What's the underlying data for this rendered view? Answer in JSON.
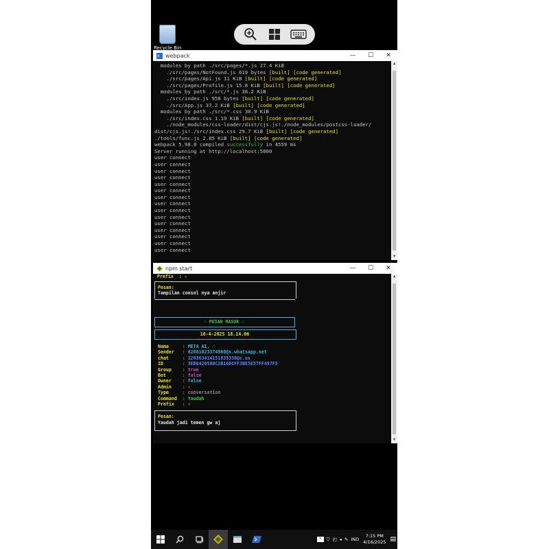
{
  "desktop": {
    "recycle_bin_label": "Recycle Bin"
  },
  "webpack_window": {
    "title": "webpack",
    "lines": [
      [
        {
          "t": "  modules by path ./src/pages/*.js 27.4 KiB",
          "c": ""
        }
      ],
      [
        {
          "t": "    ./src/pages/NotFound.js 619 bytes ",
          "c": ""
        },
        {
          "t": "[built]",
          "c": "y"
        },
        {
          "t": " [code generated]",
          "c": "y"
        }
      ],
      [
        {
          "t": "    ./src/pages/Api.js 11 KiB ",
          "c": ""
        },
        {
          "t": "[built]",
          "c": "y"
        },
        {
          "t": " [code generated]",
          "c": "y"
        }
      ],
      [
        {
          "t": "    ./src/pages/Profile.js 15.8 KiB ",
          "c": ""
        },
        {
          "t": "[built]",
          "c": "y"
        },
        {
          "t": " [code generated]",
          "c": "y"
        }
      ],
      [
        {
          "t": "  modules by path ./src/*.js 38.2 KiB",
          "c": ""
        }
      ],
      [
        {
          "t": "    ./src/index.js 958 bytes ",
          "c": ""
        },
        {
          "t": "[built]",
          "c": "y"
        },
        {
          "t": " [code generated]",
          "c": "y"
        }
      ],
      [
        {
          "t": "    ./src/App.js 37.2 KiB ",
          "c": ""
        },
        {
          "t": "[built]",
          "c": "y"
        },
        {
          "t": " [code generated]",
          "c": "y"
        }
      ],
      [
        {
          "t": "  modules by path ./src/*.css 30.9 KiB",
          "c": ""
        }
      ],
      [
        {
          "t": "    ./src/index.css 1.19 KiB ",
          "c": ""
        },
        {
          "t": "[built]",
          "c": "y"
        },
        {
          "t": " [code generated]",
          "c": "y"
        }
      ],
      [
        {
          "t": "    ./node_modules/css-loader/dist/cjs.js!./node_modules/postcss-loader/",
          "c": ""
        }
      ],
      [
        {
          "t": "dist/cjs.js!./src/index.css 29.7 KiB ",
          "c": ""
        },
        {
          "t": "[built]",
          "c": "y"
        },
        {
          "t": " [code generated]",
          "c": "y"
        }
      ],
      [
        {
          "t": "./tools/func.js 2.85 KiB ",
          "c": ""
        },
        {
          "t": "[built]",
          "c": "y"
        },
        {
          "t": " [code generated]",
          "c": "y"
        }
      ],
      [
        {
          "t": "webpack 5.98.0 compiled ",
          "c": ""
        },
        {
          "t": "successfully",
          "c": "g"
        },
        {
          "t": " in 4559 ms",
          "c": ""
        }
      ],
      [
        {
          "t": "Server running at http://localhost:5000",
          "c": ""
        }
      ],
      [
        {
          "t": "user connect",
          "c": ""
        }
      ],
      [
        {
          "t": "user connect",
          "c": ""
        }
      ],
      [
        {
          "t": "user connect",
          "c": ""
        }
      ],
      [
        {
          "t": "user connect",
          "c": ""
        }
      ],
      [
        {
          "t": "user connect",
          "c": ""
        }
      ],
      [
        {
          "t": "user connect",
          "c": ""
        }
      ],
      [
        {
          "t": "user connect",
          "c": ""
        }
      ],
      [
        {
          "t": "user connect",
          "c": ""
        }
      ],
      [
        {
          "t": "user connect",
          "c": ""
        }
      ],
      [
        {
          "t": "user connect",
          "c": ""
        }
      ],
      [
        {
          "t": "user connect",
          "c": ""
        }
      ],
      [
        {
          "t": "user connect",
          "c": ""
        }
      ],
      [
        {
          "t": "user connect",
          "c": ""
        }
      ],
      [
        {
          "t": "user connect",
          "c": ""
        }
      ],
      [
        {
          "t": "user connect",
          "c": ""
        }
      ]
    ]
  },
  "npm_window": {
    "title": "npm start",
    "prev_prefix": "Prefix  : ✕",
    "prev_pesan_label": "Pesan:",
    "prev_pesan_text": "Tampilan consol nya anjir",
    "header": "☝ PESAN MASUK ☝",
    "datetime": "16-4-2025 18.14.06",
    "fields": [
      {
        "k": "Nama    ",
        "v": "META AI, ☝",
        "c": "cy"
      },
      {
        "k": "Sender  ",
        "v": "62881023374960@s.whatsapp.net",
        "c": "cy"
      },
      {
        "k": "chat    ",
        "v": "120363414151839356@c.us",
        "c": "bl"
      },
      {
        "k": "ID      ",
        "v": "3EB0428580C2B160CFF3BE5E57FF497F5",
        "c": "bl"
      },
      {
        "k": "Group   ",
        "v": "true",
        "c": "mg"
      },
      {
        "k": "Bot     ",
        "v": "false",
        "c": "mg"
      },
      {
        "k": "Owner   ",
        "v": "false",
        "c": "cy"
      },
      {
        "k": "Admin   ",
        "v": "✕",
        "c": "rd"
      },
      {
        "k": "Type    ",
        "v": "conversation",
        "c": "gr"
      },
      {
        "k": "Command ",
        "v": "Yaudah",
        "c": "g"
      },
      {
        "k": "Prefix  ",
        "v": "✕",
        "c": "gr"
      }
    ],
    "pesan_label": "Pesan:",
    "pesan_text": "Yaudah jadi temen gw aj"
  },
  "taskbar": {
    "lang": "IND",
    "time": "7:15 PM",
    "date": "4/16/2025"
  },
  "colors": {
    "terminal_bg": "#0c0c0c",
    "yellow": "#e5e510",
    "green": "#3dc43d",
    "cyan": "#29b8db"
  }
}
